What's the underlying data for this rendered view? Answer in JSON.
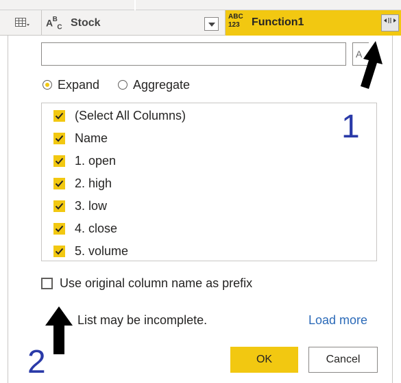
{
  "header": {
    "col1": {
      "type_icon": "table-icon"
    },
    "col2": {
      "type_text_a": "A",
      "type_text_b": "B",
      "type_text_c": "C",
      "label": "Stock"
    },
    "col3": {
      "type_line1": "ABC",
      "type_line2": "123",
      "label": "Function1",
      "expand_icon": "expand-columns-icon"
    }
  },
  "search": {
    "value": "",
    "placeholder": ""
  },
  "mode": {
    "options": [
      {
        "label": "Expand",
        "selected": true
      },
      {
        "label": "Aggregate",
        "selected": false
      }
    ]
  },
  "columns": [
    {
      "label": "(Select All Columns)",
      "checked": true
    },
    {
      "label": "Name",
      "checked": true
    },
    {
      "label": "1. open",
      "checked": true
    },
    {
      "label": "2. high",
      "checked": true
    },
    {
      "label": "3. low",
      "checked": true
    },
    {
      "label": "4. close",
      "checked": true
    },
    {
      "label": "5. volume",
      "checked": true
    }
  ],
  "prefix": {
    "label": "Use original column name as prefix",
    "checked": false
  },
  "notice": {
    "text": "List may be incomplete.",
    "link": "Load more"
  },
  "buttons": {
    "ok": "OK",
    "cancel": "Cancel"
  },
  "annotations": {
    "one": "1",
    "two": "2"
  },
  "colors": {
    "accent": "#f2c811",
    "link": "#2b6ab8",
    "annotation": "#2a3aa8"
  }
}
